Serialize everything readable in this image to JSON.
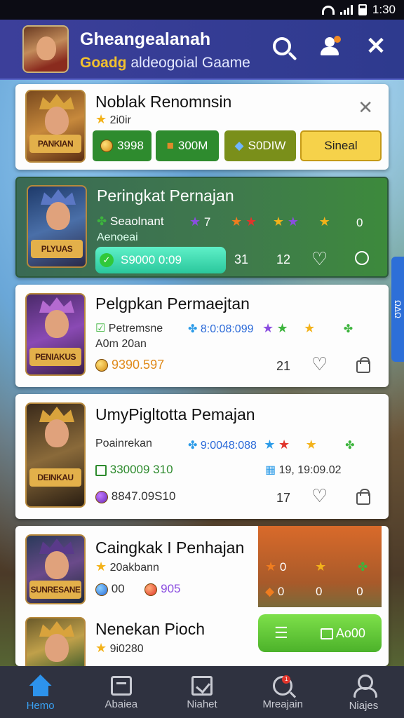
{
  "status": {
    "time": "1:30"
  },
  "header": {
    "title": "Gheangealanah",
    "subtitle_highlight": "Goadg",
    "subtitle_rest": "aldeogoial Gaame"
  },
  "cards": [
    {
      "title": "Noblak Renomnsin",
      "thumb_label": "PANKIAN",
      "rating": "2i0ir",
      "chips": [
        "3998",
        "300M",
        "S0DIW",
        "Sineal"
      ]
    },
    {
      "title": "Peringkat Pernajan",
      "thumb_label": "PLYUAS",
      "line1": "Seaolnant",
      "line1_star_value": "7",
      "line2": "Aenoeai",
      "progress_value": "S9000 0:09",
      "count_a": "31",
      "count_b": "12",
      "side_value": "0"
    },
    {
      "title": "Pelgpkan Permaejtan",
      "thumb_label": "PENIAKUS",
      "line1": "Petremsne",
      "line1_value": "8:0:08:099",
      "line2": "A0m 20an",
      "line3_value": "9390.597",
      "count": "21"
    },
    {
      "title": "UmyPigltotta Pemajan",
      "thumb_label": "DEINKAU",
      "line1": "Poainrekan",
      "line1_value": "9:0048:088",
      "line2_value": "330009 310",
      "line2_right": "19, 19:09.02",
      "line3_value": "8847.09S10",
      "count": "17"
    },
    {
      "title": "Caingkak I Penhajan",
      "thumb_label": "SUNRESANE",
      "line1": "20akbann",
      "stat_a": "00",
      "stat_b": "905",
      "panel_a": "0",
      "panel_b": "0",
      "panel_c": "0"
    },
    {
      "title": "Nenekan Pioch",
      "line1": "9i0280",
      "action_value": "Ao00"
    }
  ],
  "tabs": [
    {
      "label": "Hemo",
      "active": true
    },
    {
      "label": "Abaiea",
      "active": false
    },
    {
      "label": "Niahet",
      "active": false
    },
    {
      "label": "Mreajain",
      "active": false,
      "badge": "1"
    },
    {
      "label": "Niajes",
      "active": false
    }
  ],
  "side_tab": {
    "label": "ΩΔΩ"
  },
  "colors": {
    "header": "#3c3f9a",
    "green_chip": "#2e8b2e",
    "olive_chip": "#7a8f1a",
    "yellow_chip": "#f6d24a",
    "progress": "#3ad9b0",
    "orange_panel": "#d96a2a",
    "green_action": "#5cc82a"
  }
}
